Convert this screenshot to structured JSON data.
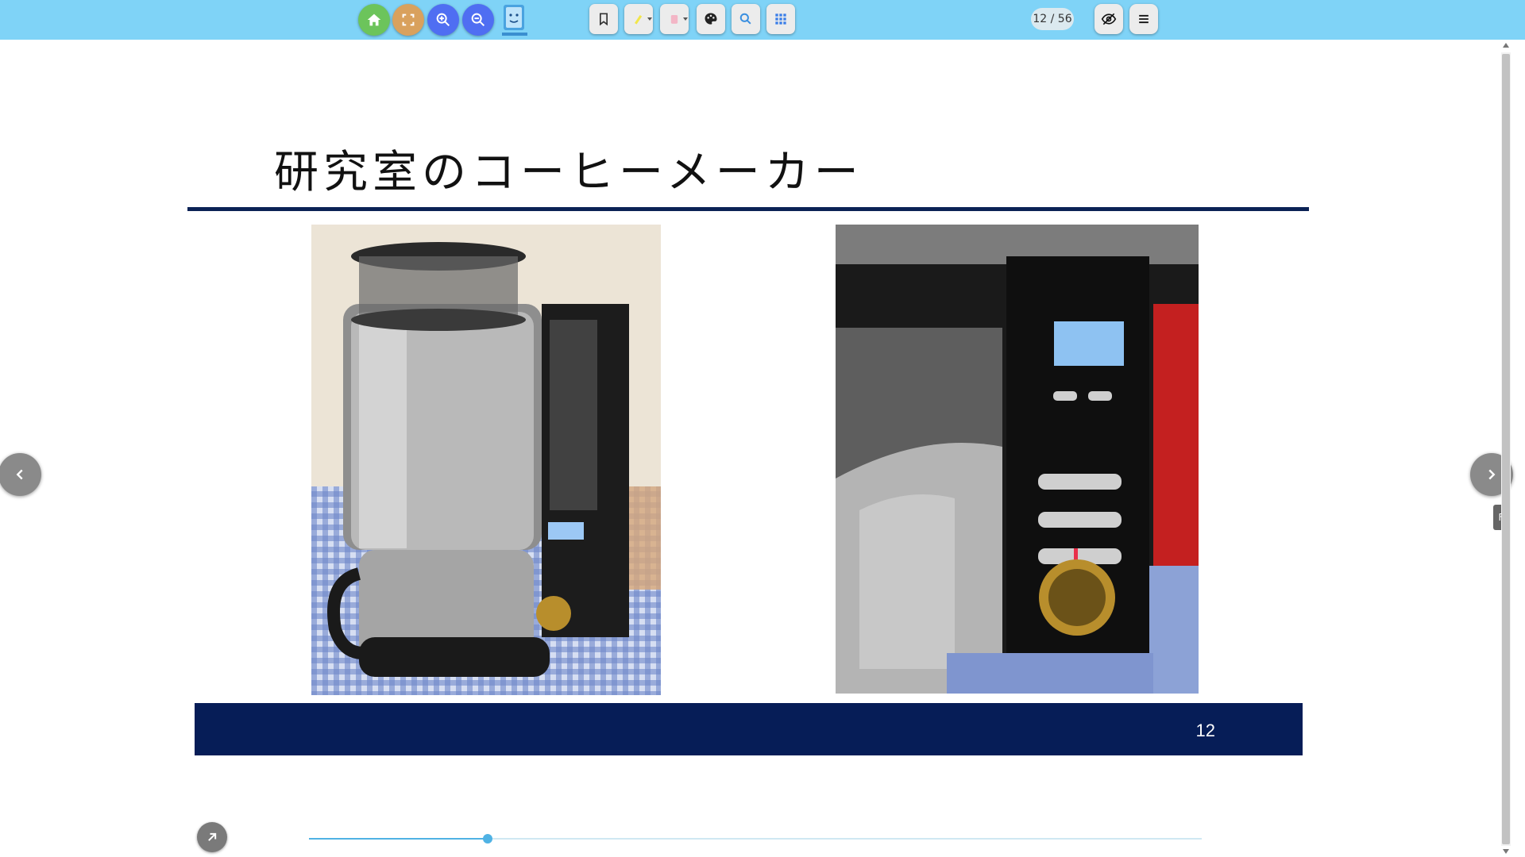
{
  "toolbar": {
    "buttons": [
      {
        "name": "home-icon",
        "color": "#6cc45b"
      },
      {
        "name": "fullscreen-icon",
        "color": "#d9a15d"
      },
      {
        "name": "zoom-in-icon",
        "color": "#4f6ef2"
      },
      {
        "name": "zoom-out-icon",
        "color": "#4f6ef2"
      }
    ],
    "page_counter": "12 / 56"
  },
  "slide": {
    "title": "研究室のコーヒーメーカー",
    "page_number": "12",
    "rule_color": "#0b2255",
    "footer_color": "#061d57"
  },
  "progress": {
    "current_page": 12,
    "total_pages": 56,
    "fraction": 0.2
  },
  "side_tab": {
    "label": "F"
  }
}
